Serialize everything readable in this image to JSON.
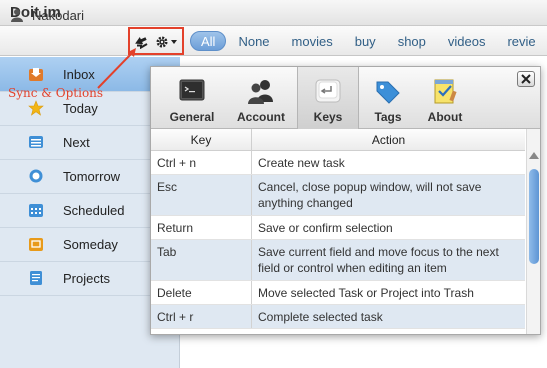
{
  "app": {
    "title": "Doit.im"
  },
  "user": {
    "name": "Nakodari"
  },
  "filters": [
    "All",
    "None",
    "movies",
    "buy",
    "shop",
    "videos",
    "revie"
  ],
  "active_filter": "All",
  "annotation": {
    "label": "Sync & Options",
    "color": "#e3412b"
  },
  "sidebar": {
    "items": [
      {
        "label": "Inbox",
        "icon": "inbox-icon",
        "color": "#e07a2a",
        "selected": true
      },
      {
        "label": "Today",
        "icon": "star-icon",
        "color": "#f2b515"
      },
      {
        "label": "Next",
        "icon": "list-icon",
        "color": "#3f8fd6"
      },
      {
        "label": "Tomorrow",
        "icon": "circle-icon",
        "color": "#3f8fd6"
      },
      {
        "label": "Scheduled",
        "icon": "calendar-icon",
        "color": "#3f8fd6"
      },
      {
        "label": "Someday",
        "icon": "box-icon",
        "color": "#e89a1a"
      },
      {
        "label": "Projects",
        "icon": "document-icon",
        "color": "#3f8fd6"
      }
    ]
  },
  "popup": {
    "tabs": [
      {
        "label": "General",
        "icon": "terminal-icon"
      },
      {
        "label": "Account",
        "icon": "users-icon"
      },
      {
        "label": "Keys",
        "icon": "keyboard-key-icon",
        "active": true
      },
      {
        "label": "Tags",
        "icon": "tag-icon"
      },
      {
        "label": "About",
        "icon": "notepad-icon"
      }
    ],
    "table": {
      "headers": {
        "key": "Key",
        "action": "Action"
      },
      "rows": [
        {
          "key": "Ctrl + n",
          "action": "Create new task"
        },
        {
          "key": "Esc",
          "action": "Cancel, close popup window, will not save anything changed"
        },
        {
          "key": "Return",
          "action": "Save or confirm selection"
        },
        {
          "key": "Tab",
          "action": "Save current field and move focus to the next field or control when editing an item"
        },
        {
          "key": "Delete",
          "action": "Move selected Task or Project into Trash"
        },
        {
          "key": "Ctrl + r",
          "action": "Complete selected task"
        }
      ]
    }
  }
}
